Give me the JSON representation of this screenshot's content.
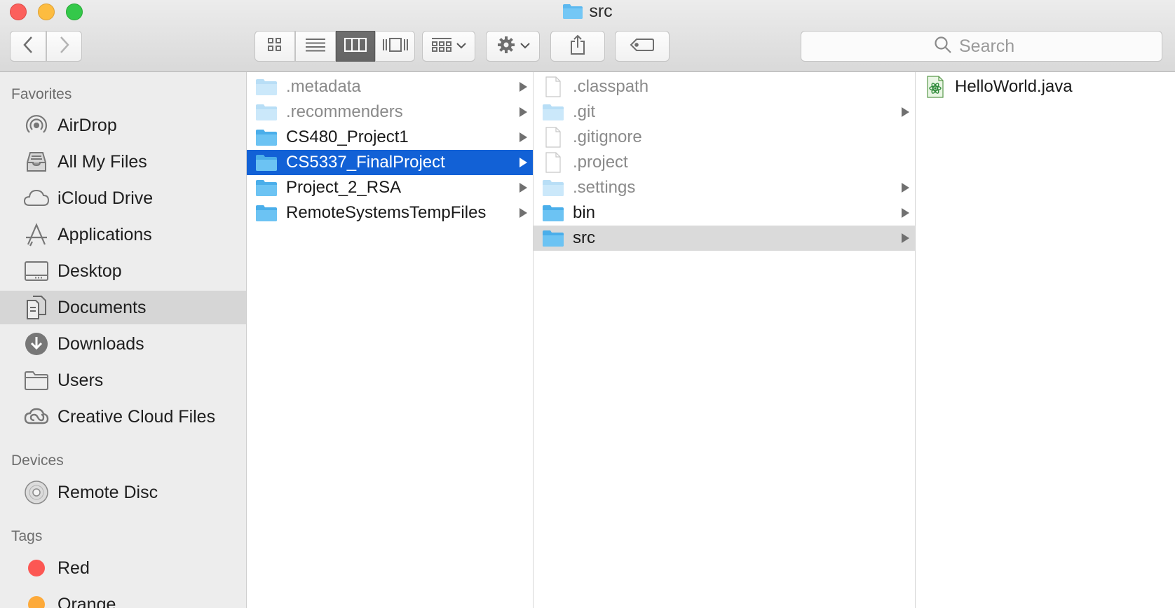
{
  "window": {
    "title": "src",
    "title_icon": "folder-icon"
  },
  "toolbar": {
    "back_icon": "chevron-left-icon",
    "forward_icon": "chevron-right-icon",
    "view_modes": [
      {
        "name": "icon-view",
        "icon": "grid-icon"
      },
      {
        "name": "list-view",
        "icon": "list-icon"
      },
      {
        "name": "column-view",
        "icon": "columns-icon",
        "active": true
      },
      {
        "name": "cover-flow-view",
        "icon": "cover-flow-icon"
      }
    ],
    "arrange_icon": "arrange-icon",
    "action_icon": "gear-icon",
    "share_icon": "share-icon",
    "tags_icon": "tag-icon",
    "search": {
      "placeholder": "Search",
      "value": ""
    }
  },
  "sidebar": {
    "favorites_header": "Favorites",
    "favorites": [
      {
        "label": "AirDrop",
        "icon": "airdrop-icon"
      },
      {
        "label": "All My Files",
        "icon": "all-files-icon"
      },
      {
        "label": "iCloud Drive",
        "icon": "cloud-icon"
      },
      {
        "label": "Applications",
        "icon": "applications-icon"
      },
      {
        "label": "Desktop",
        "icon": "desktop-icon"
      },
      {
        "label": "Documents",
        "icon": "documents-icon",
        "selected": true
      },
      {
        "label": "Downloads",
        "icon": "downloads-icon"
      },
      {
        "label": "Users",
        "icon": "folder-icon"
      },
      {
        "label": "Creative Cloud Files",
        "icon": "creative-cloud-icon"
      }
    ],
    "devices_header": "Devices",
    "devices": [
      {
        "label": "Remote Disc",
        "icon": "disc-icon"
      }
    ],
    "tags_header": "Tags",
    "tags": [
      {
        "label": "Red",
        "color": "#fc5753"
      },
      {
        "label": "Orange",
        "color": "#fdaa3a"
      }
    ]
  },
  "columns": {
    "col1": [
      {
        "label": ".metadata",
        "type": "folder",
        "hidden": true,
        "has_children": true
      },
      {
        "label": ".recommenders",
        "type": "folder",
        "hidden": true,
        "has_children": true
      },
      {
        "label": "CS480_Project1",
        "type": "folder",
        "hidden": false,
        "has_children": true
      },
      {
        "label": "CS5337_FinalProject",
        "type": "folder",
        "hidden": false,
        "has_children": true,
        "selected": "active"
      },
      {
        "label": "Project_2_RSA",
        "type": "folder",
        "hidden": false,
        "has_children": true
      },
      {
        "label": "RemoteSystemsTempFiles",
        "type": "folder",
        "hidden": false,
        "has_children": true
      }
    ],
    "col2": [
      {
        "label": ".classpath",
        "type": "file",
        "hidden": true,
        "has_children": false
      },
      {
        "label": ".git",
        "type": "folder",
        "hidden": true,
        "has_children": true
      },
      {
        "label": ".gitignore",
        "type": "file",
        "hidden": true,
        "has_children": false
      },
      {
        "label": ".project",
        "type": "file",
        "hidden": true,
        "has_children": false
      },
      {
        "label": ".settings",
        "type": "folder",
        "hidden": true,
        "has_children": true
      },
      {
        "label": "bin",
        "type": "folder",
        "hidden": false,
        "has_children": true
      },
      {
        "label": "src",
        "type": "folder",
        "hidden": false,
        "has_children": true,
        "selected": "inactive"
      }
    ],
    "col3": [
      {
        "label": "HelloWorld.java",
        "type": "java",
        "hidden": false,
        "has_children": false
      }
    ]
  },
  "colors": {
    "selection_active": "#1261d6",
    "selection_inactive": "#dadada",
    "folder": "#5cb8ef"
  }
}
